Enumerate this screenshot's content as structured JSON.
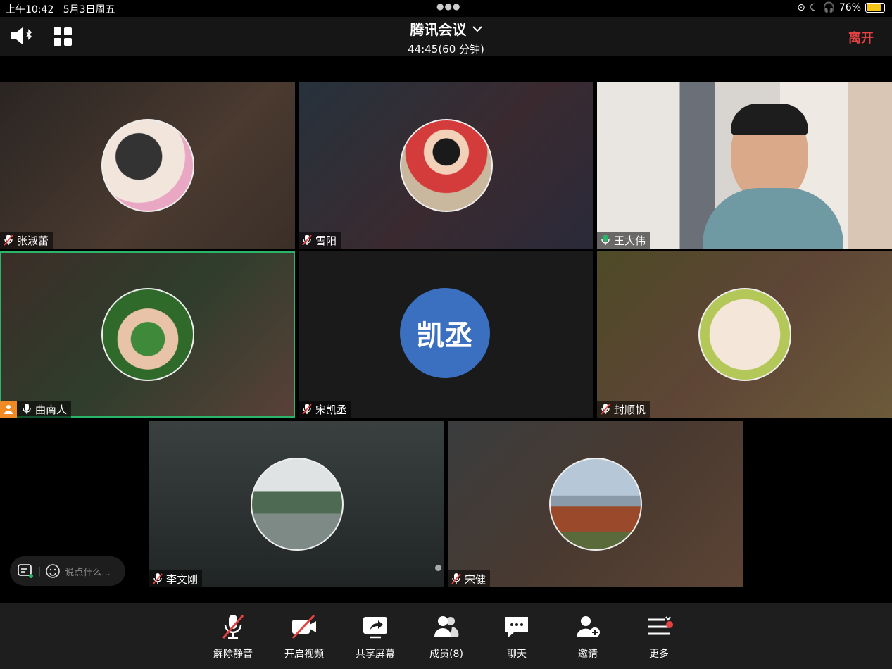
{
  "status": {
    "time": "上午10:42",
    "date": "5月3日周五",
    "battery": "76%"
  },
  "header": {
    "title": "腾讯会议",
    "timer": "44:45(60 分钟)",
    "leave_label": "离开"
  },
  "participants": [
    {
      "name": "张淑蕾",
      "muted": true
    },
    {
      "name": "雪阳",
      "muted": true
    },
    {
      "name": "王大伟",
      "muted": false
    },
    {
      "name": "曲南人",
      "muted": false
    },
    {
      "name": "宋凯丞",
      "muted": true,
      "avatar_text": "凯丞"
    },
    {
      "name": "封顺帆",
      "muted": true
    },
    {
      "name": "李文刚",
      "muted": true
    },
    {
      "name": "宋健",
      "muted": true
    }
  ],
  "chat": {
    "placeholder": "说点什么..."
  },
  "toolbar": {
    "unmute": "解除静音",
    "video": "开启视频",
    "share": "共享屏幕",
    "members": "成员(8)",
    "chat": "聊天",
    "invite": "邀请",
    "more": "更多"
  },
  "colors": {
    "leave": "#e54343",
    "active_border": "#2bb56a",
    "avatar_blue": "#3b6fc0"
  }
}
